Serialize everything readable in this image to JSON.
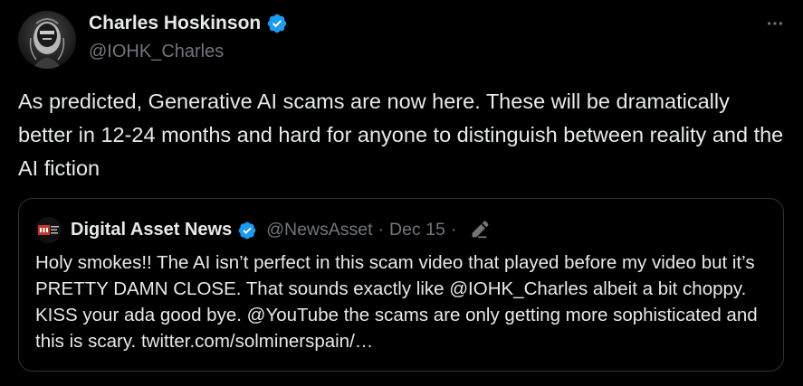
{
  "author": {
    "display_name": "Charles Hoskinson",
    "handle": "@IOHK_Charles",
    "verified": true,
    "avatar_icon": "portrait-sketch-avatar"
  },
  "tweet": {
    "text": "As predicted, Generative AI scams are now here. These will be dramatically better in 12-24 months and hard for anyone to distinguish between reality and the AI fiction"
  },
  "more_icon": "more-horizontal-icon",
  "quoted_tweet": {
    "avatar_icon": "dan-logo-avatar",
    "display_name": "Digital Asset News",
    "verified": true,
    "handle": "@NewsAsset",
    "separator": "·",
    "date": "Dec 15",
    "edited_icon": "edit-pencil-icon",
    "text": "Holy smokes!! The AI isn’t perfect in this scam video that played before my video but it’s PRETTY DAMN CLOSE. That sounds exactly like @IOHK_Charles albeit a bit choppy. KISS your ada good bye. @YouTube the scams are only getting more sophisticated and this is scary. twitter.com/solminerspain/…"
  },
  "colors": {
    "background": "#000000",
    "text_primary": "#e7e9ea",
    "text_secondary": "#71767b",
    "verified_blue": "#1d9bf0",
    "border": "#2f3336"
  }
}
